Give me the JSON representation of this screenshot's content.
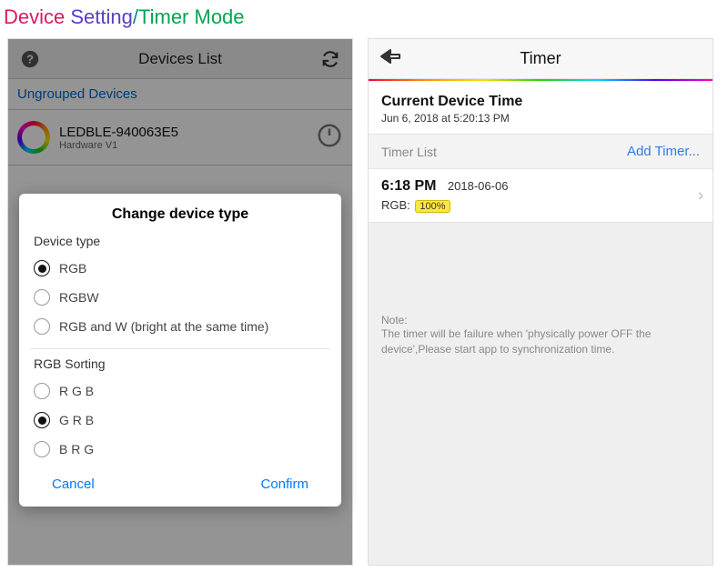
{
  "page_title": {
    "p1": "Device ",
    "p2": "Setting",
    "p3": "/",
    "p4": "Timer Mode"
  },
  "left": {
    "nav_title": "Devices List",
    "section": "Ungrouped Devices",
    "device": {
      "name": "LEDBLE-940063E5",
      "sub": "Hardware V1"
    },
    "modal": {
      "title": "Change device type",
      "group1_label": "Device type",
      "options1": [
        {
          "label": "RGB",
          "checked": true
        },
        {
          "label": "RGBW",
          "checked": false
        },
        {
          "label": "RGB and W (bright at the same time)",
          "checked": false
        }
      ],
      "group2_label": "RGB Sorting",
      "options2": [
        {
          "label": "R G B",
          "checked": false
        },
        {
          "label": "G R B",
          "checked": true
        },
        {
          "label": "B R G",
          "checked": false
        }
      ],
      "cancel": "Cancel",
      "confirm": "Confirm"
    }
  },
  "right": {
    "nav_title": "Timer",
    "current_device_time": {
      "title": "Current Device Time",
      "value": "Jun 6, 2018 at 5:20:13 PM"
    },
    "timer_list_label": "Timer List",
    "add_timer": "Add Timer...",
    "timer_item": {
      "time": "6:18 PM",
      "date": "2018-06-06",
      "rgb_label": "RGB: ",
      "percent": "100%"
    },
    "note_heading": "Note:",
    "note_body": "The timer will be failure when 'physically power OFF the device',Please start app to synchronization time."
  }
}
